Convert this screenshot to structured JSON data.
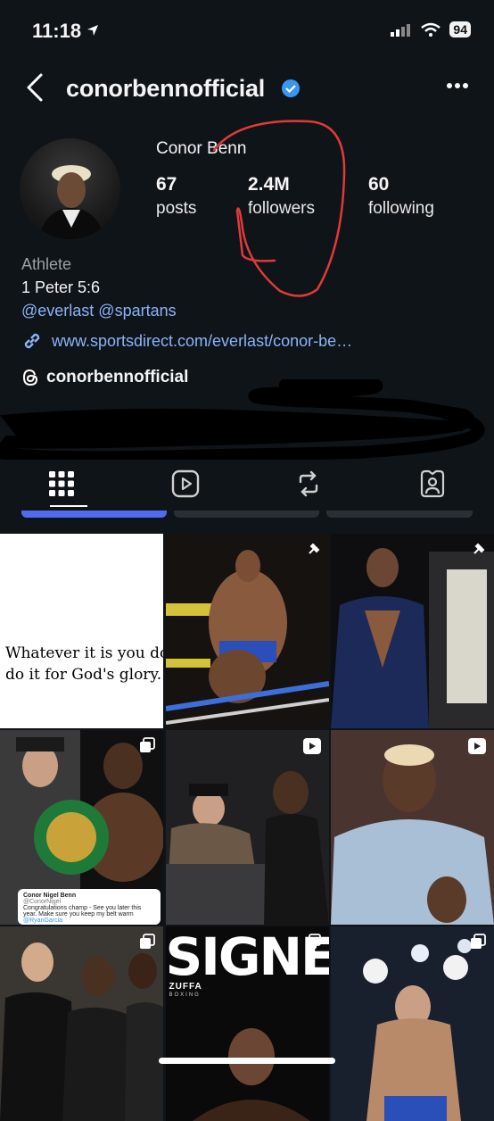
{
  "status_bar": {
    "time": "11:18",
    "battery": "94"
  },
  "header": {
    "username": "conorbennofficial"
  },
  "profile": {
    "display_name": "Conor Benn",
    "stats": [
      {
        "value": "67",
        "label": "posts"
      },
      {
        "value": "2.4M",
        "label": "followers"
      },
      {
        "value": "60",
        "label": "following"
      }
    ],
    "category": "Athlete",
    "bio": "1 Peter 5:6",
    "mentions": "@everlast @spartans",
    "link": "www.sportsdirect.com/everlast/conor-be…",
    "threads_handle": "conorbennofficial"
  },
  "annotation": {
    "color": "#e03a3a"
  },
  "colors": {
    "background": "#0f1419",
    "link": "#8ab4f8",
    "accent_pill": "#4f6bf0"
  },
  "tabs": [
    {
      "icon": "grid-icon",
      "active": true
    },
    {
      "icon": "reels-icon",
      "active": false
    },
    {
      "icon": "repost-icon",
      "active": false
    },
    {
      "icon": "tagged-icon",
      "active": false
    }
  ],
  "posts": {
    "quote_line1": "Whatever it is you do",
    "quote_line2": "do it for God's glory.",
    "signed_text": "SIGNED",
    "signed_brand": "ZUFFA",
    "signed_brand_sub": "BOXING",
    "tweet_name": "Conor Nigel Benn",
    "tweet_handle": "@ConorNigel",
    "tweet_text": "Congratulations champ - See you later this year. Make sure you keep my belt warm",
    "tweet_mention": "@RyanGarcia"
  }
}
